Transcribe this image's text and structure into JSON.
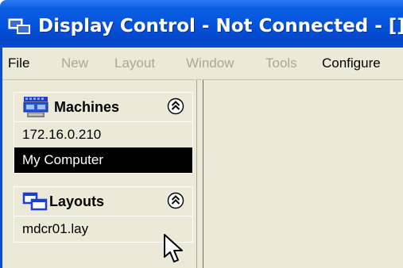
{
  "window": {
    "title": "Display Control - Not Connected - []",
    "icon": "display-control-app-icon"
  },
  "menu": {
    "items": [
      {
        "label": "File",
        "enabled": true
      },
      {
        "label": "New",
        "enabled": false
      },
      {
        "label": "Layout",
        "enabled": false
      },
      {
        "label": "Window",
        "enabled": false
      },
      {
        "label": "Tools",
        "enabled": false
      },
      {
        "label": "Configure",
        "enabled": true
      }
    ]
  },
  "sidebar": {
    "machines": {
      "title": "Machines",
      "icon": "machines-icon",
      "collapse_icon": "double-chevron-up-icon",
      "items": [
        {
          "label": "172.16.0.210",
          "selected": false
        },
        {
          "label": "My Computer",
          "selected": true
        }
      ]
    },
    "layouts": {
      "title": "Layouts",
      "icon": "layouts-icon",
      "collapse_icon": "double-chevron-up-icon",
      "items": [
        {
          "label": "mdcr01.lay",
          "selected": false
        }
      ]
    }
  },
  "colors": {
    "titlebar": "#0552dc",
    "chrome": "#ece9d8",
    "disabled_text": "#aca899",
    "selection": "#000000"
  },
  "cursor": "arrow-pointer-icon"
}
